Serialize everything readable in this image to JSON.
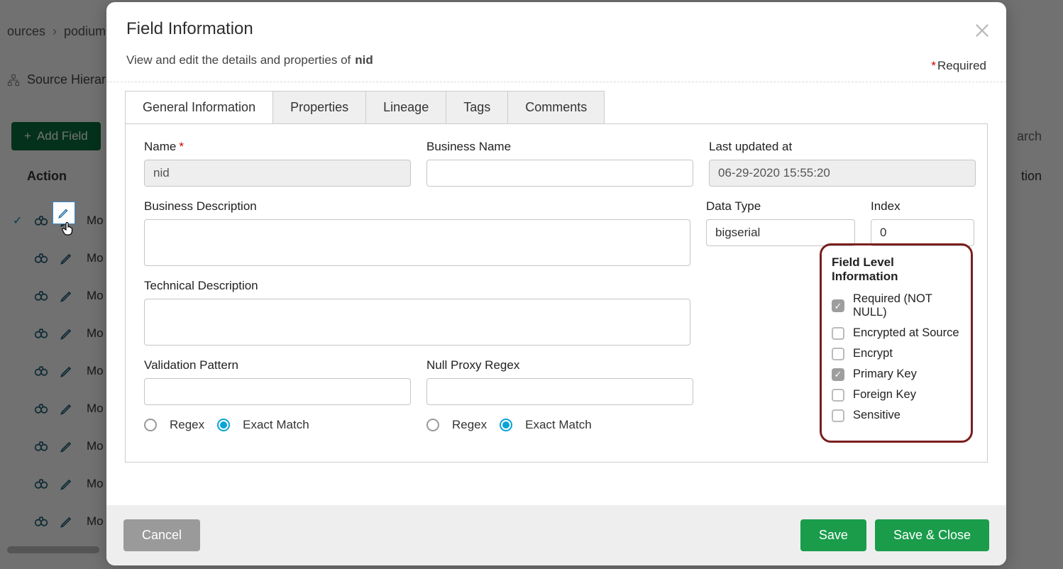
{
  "backdrop": {
    "breadcrumb": {
      "a": "ources",
      "b": "podium"
    },
    "hierarchy_label": "Source Hierarc",
    "add_field_label": "Add Field",
    "search_placeholder": "arch",
    "column_action": "Action",
    "column_right": "tion",
    "row_text": "Mo",
    "footer_count": ""
  },
  "modal": {
    "title": "Field Information",
    "subtitle_prefix": "View and edit the details and properties of",
    "field_name": "nid",
    "required_label": "Required",
    "tabs": {
      "general": "General Information",
      "properties": "Properties",
      "lineage": "Lineage",
      "tags": "Tags",
      "comments": "Comments"
    },
    "labels": {
      "name": "Name",
      "business_name": "Business Name",
      "last_updated": "Last updated at",
      "business_description": "Business Description",
      "data_type": "Data Type",
      "index": "Index",
      "technical_description": "Technical Description",
      "validation_pattern": "Validation Pattern",
      "null_proxy": "Null Proxy Regex",
      "regex": "Regex",
      "exact_match": "Exact Match"
    },
    "values": {
      "name": "nid",
      "business_name": "",
      "last_updated": "06-29-2020 15:55:20",
      "business_description": "",
      "data_type": "bigserial",
      "index": "0",
      "technical_description": "",
      "validation_pattern": "",
      "null_proxy": "",
      "validation_mode": "exact",
      "nullproxy_mode": "exact"
    },
    "fli": {
      "title": "Field Level Information",
      "items": [
        {
          "key": "required",
          "label": "Required (NOT NULL)",
          "checked": true
        },
        {
          "key": "enc_src",
          "label": "Encrypted at Source",
          "checked": false
        },
        {
          "key": "encrypt",
          "label": "Encrypt",
          "checked": false
        },
        {
          "key": "pk",
          "label": "Primary Key",
          "checked": true
        },
        {
          "key": "fk",
          "label": "Foreign Key",
          "checked": false
        },
        {
          "key": "sensitive",
          "label": "Sensitive",
          "checked": false
        }
      ]
    },
    "buttons": {
      "cancel": "Cancel",
      "save": "Save",
      "save_close": "Save & Close"
    }
  }
}
